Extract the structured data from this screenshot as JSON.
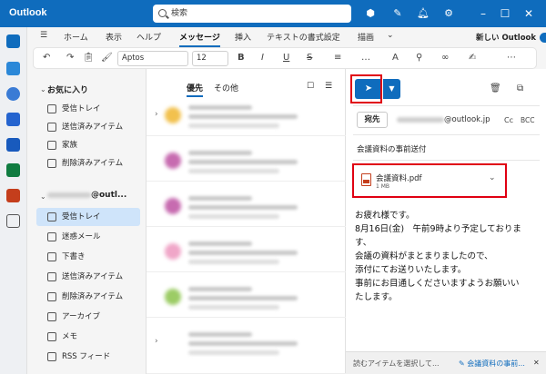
{
  "app": {
    "title": "Outlook"
  },
  "search": {
    "placeholder": "検索"
  },
  "menu": {
    "tabs": [
      "ホーム",
      "表示",
      "ヘルプ",
      "メッセージ",
      "挿入",
      "テキストの書式設定",
      "描画"
    ],
    "active": "メッセージ",
    "toggle_label": "新しい Outlook"
  },
  "ribbon": {
    "font": "Aptos",
    "size": "12"
  },
  "folders": {
    "favorites_label": "お気に入り",
    "favorites": [
      "受信トレイ",
      "送信済みアイテム",
      "家族",
      "削除済みアイテム"
    ],
    "account_suffix": "@outl...",
    "account_items": [
      "受信トレイ",
      "迷惑メール",
      "下書き",
      "送信済みアイテム",
      "削除済みアイテム",
      "アーカイブ",
      "メモ",
      "RSS フィード"
    ],
    "selected": "受信トレイ"
  },
  "message_list": {
    "tabs": [
      "優先",
      "その他"
    ]
  },
  "compose": {
    "from_label": "宛先",
    "from_domain": "@outlook.jp",
    "cc": "Cc",
    "bcc": "BCC",
    "subject": "会議資料の事前送付",
    "attachment": {
      "name": "会議資料.pdf",
      "size": "1 MB"
    },
    "body_lines": [
      "お疲れ様です。",
      "8月16日(金)　午前9時より予定しておりま",
      "す、",
      "会議の資料がまとまりましたので、",
      "添付にてお送りいたします。",
      "事前にお目通しくださいますようお願いい",
      "たします。"
    ]
  },
  "bottom_tabs": [
    "読むアイテムを選択して...",
    "会議資料の事前..."
  ],
  "colors": {
    "accent": "#0f6cbd",
    "highlight": "#e00012"
  }
}
